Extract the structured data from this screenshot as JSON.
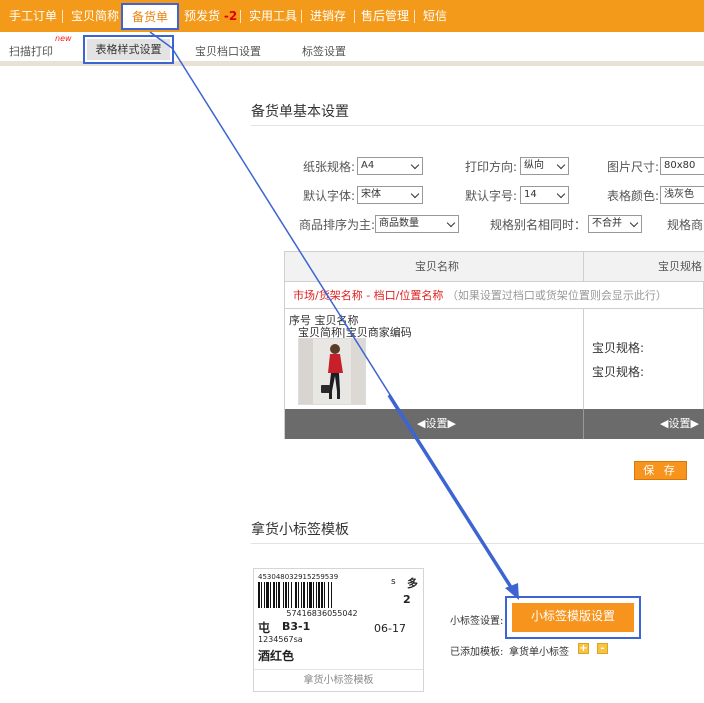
{
  "topnav": {
    "items": [
      "手工订单",
      "宝贝简称",
      "备货单",
      "预发货",
      "实用工具",
      "进销存",
      "售后管理",
      "短信"
    ],
    "presale_count": "-2",
    "badge": "new"
  },
  "subnav": {
    "items": [
      "扫描打印",
      "表格样式设置",
      "宝贝档口设置",
      "标签设置"
    ],
    "badge": "new"
  },
  "basic_settings": {
    "title": "备货单基本设置",
    "paper_label": "纸张规格:",
    "paper_value": "A4",
    "direction_label": "打印方向:",
    "direction_value": "纵向",
    "imgsize_label": "图片尺寸:",
    "imgsize_value": "80x80",
    "font_label": "默认字体:",
    "font_value": "宋体",
    "fontsize_label": "默认字号:",
    "fontsize_value": "14",
    "color_label": "表格颜色:",
    "color_value": "浅灰色",
    "sort_label": "商品排序为主:",
    "sort_value": "商品数量",
    "alias_label": "规格别名相同时：",
    "alias_value": "不合并",
    "spec_cut_label": "规格商"
  },
  "preview": {
    "col1": "宝贝名称",
    "col2": "宝贝规格",
    "market_red": "市场/货架名称 - 档口/位置名称",
    "market_note": "（如果设置过档口或货架位置则会显示此行）",
    "line1": "序号   宝贝名称",
    "line2": "宝贝简称|宝贝商家编码",
    "spec1": "宝贝规格:",
    "spec2": "宝贝规格:",
    "set_label": "设置"
  },
  "save_label": "保 存",
  "tag_section": {
    "title": "拿货小标签模板",
    "card": {
      "barcode_top": "453048032915259539",
      "s": "s",
      "duo": "多",
      "qty": "2",
      "barcode_bottom": "57416836055042",
      "loc_a": "屯",
      "loc_b": "B3-1",
      "date": "06-17",
      "code": "1234567sa",
      "color_name": "酒红色",
      "caption": "拿货小标签模板"
    },
    "setting_label": "小标签设置:",
    "setting_button": "小标签模版设置",
    "added_label": "已添加模板:",
    "added_value": "拿货单小标签",
    "add_icon": "+",
    "remove_icon": "-"
  },
  "colors": {
    "nav_orange": "#f39a1b",
    "highlight_blue": "#3c64d2",
    "button_orange": "#f7941d",
    "red_text": "#e02020"
  }
}
